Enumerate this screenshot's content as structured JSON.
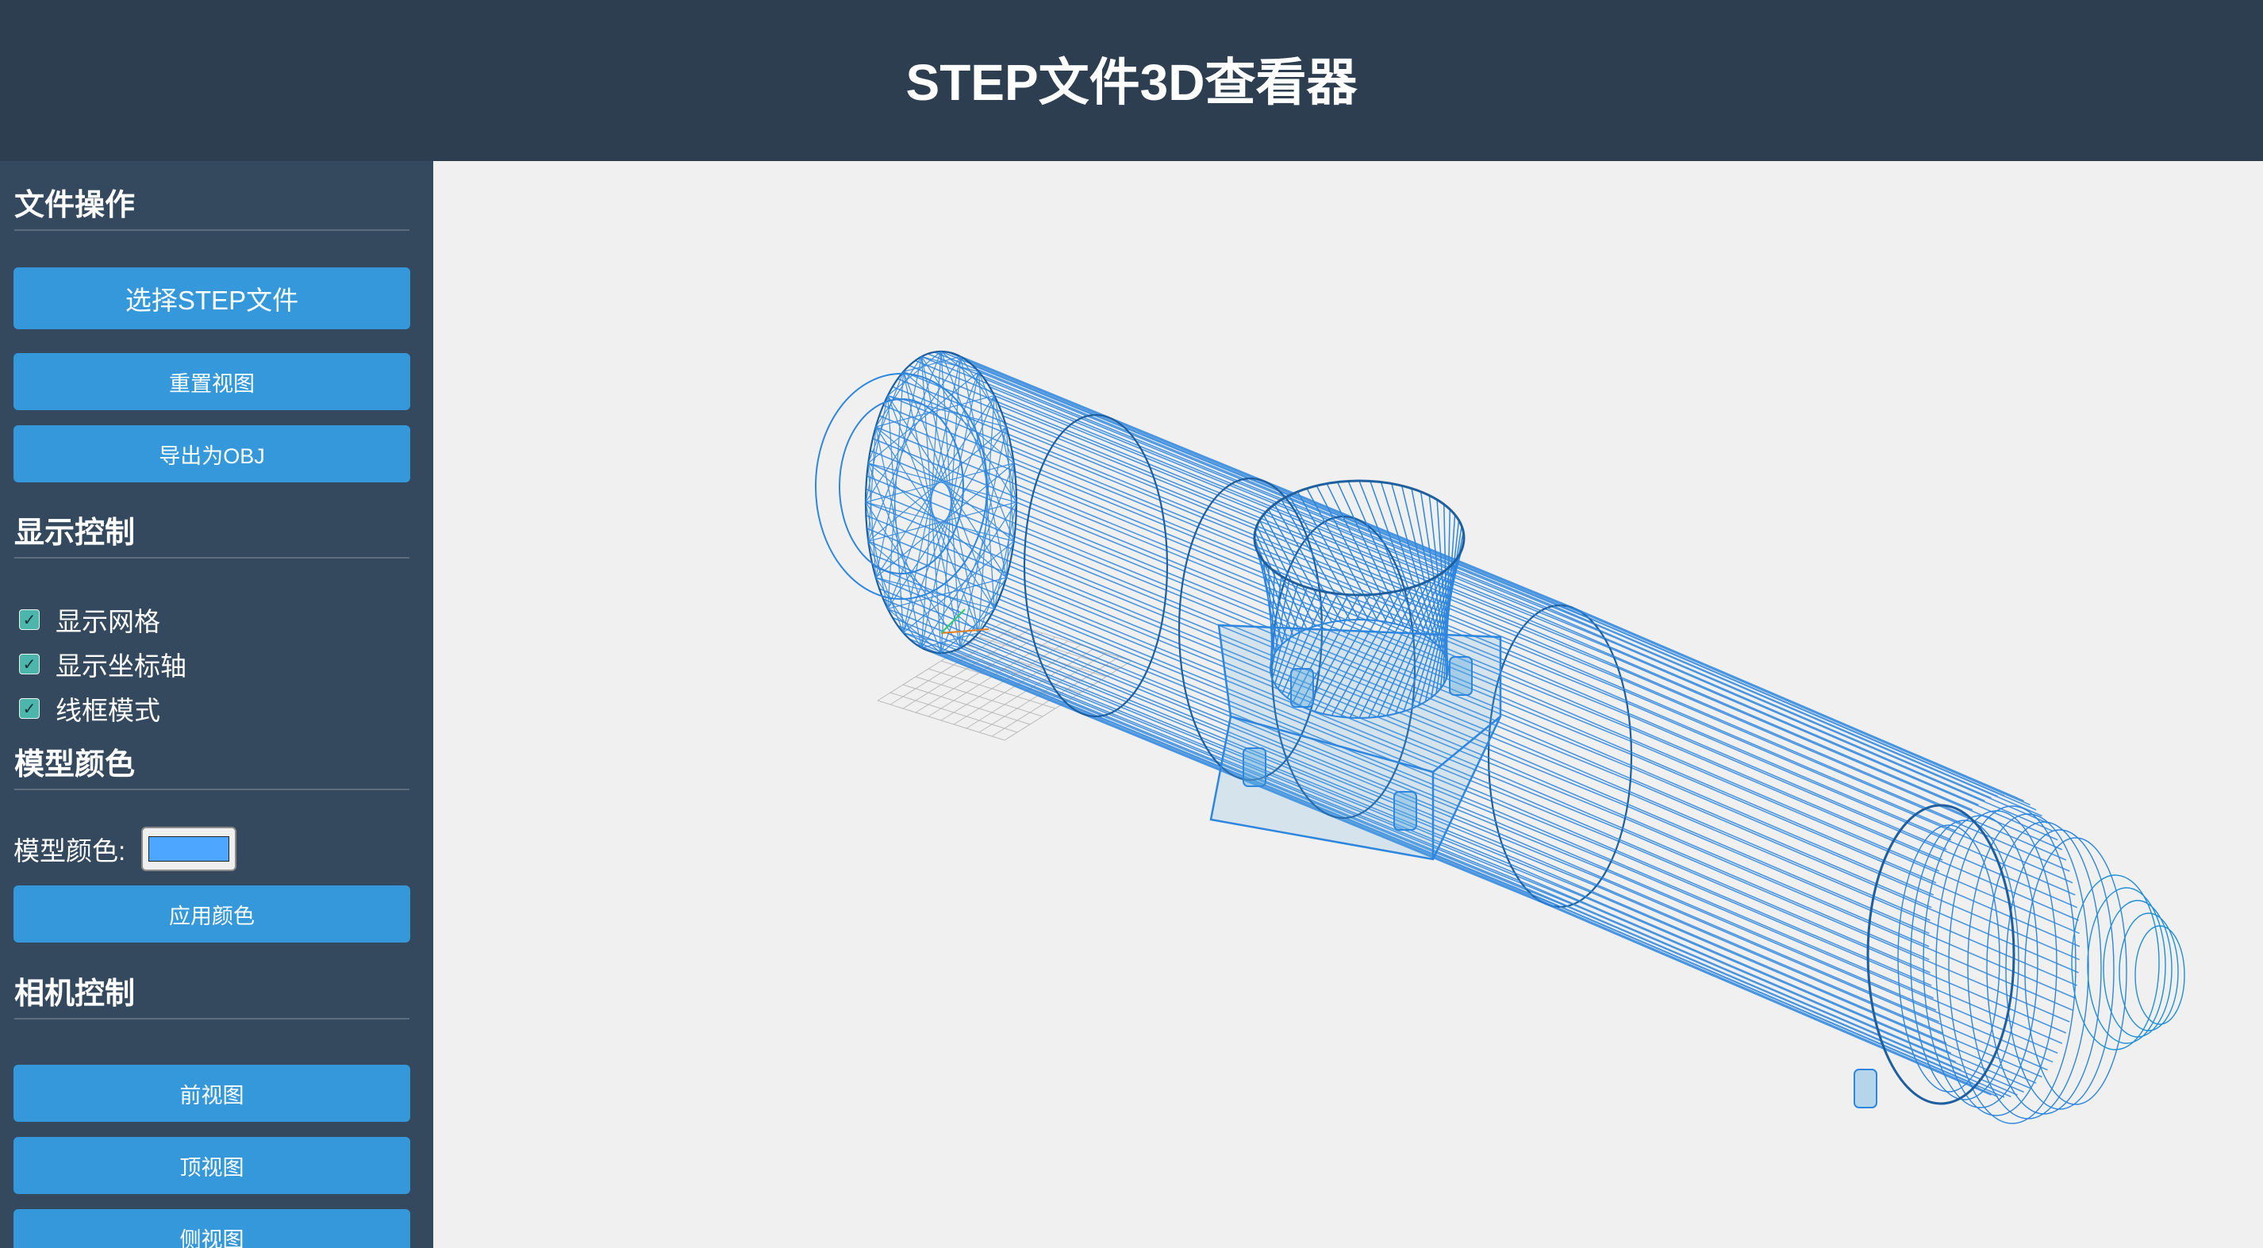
{
  "header": {
    "title": "STEP文件3D查看器"
  },
  "sidebar": {
    "file_ops": {
      "title": "文件操作",
      "select_file": "选择STEP文件",
      "reset_view": "重置视图",
      "export_obj": "导出为OBJ"
    },
    "display": {
      "title": "显示控制",
      "options": [
        {
          "label": "显示网格",
          "checked": true
        },
        {
          "label": "显示坐标轴",
          "checked": true
        },
        {
          "label": "线框模式",
          "checked": true
        }
      ]
    },
    "color": {
      "title": "模型颜色",
      "label": "模型颜色:",
      "value": "#4da6ff",
      "apply": "应用颜色"
    },
    "camera": {
      "title": "相机控制",
      "front": "前视图",
      "top": "顶视图",
      "side": "侧视图"
    }
  },
  "viewport": {
    "wire_color": "#2e86de",
    "background": "#f0f0f0"
  }
}
